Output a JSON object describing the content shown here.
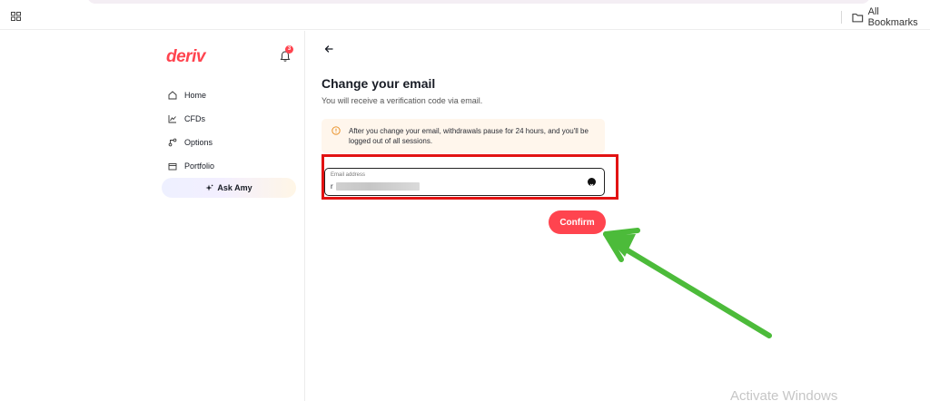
{
  "browser": {
    "bookmarks_label": "All Bookmarks"
  },
  "sidebar": {
    "logo": "deriv",
    "notification_count": "3",
    "items": [
      {
        "label": "Home",
        "icon": "home-icon"
      },
      {
        "label": "CFDs",
        "icon": "chart-icon"
      },
      {
        "label": "Options",
        "icon": "options-icon"
      },
      {
        "label": "Portfolio",
        "icon": "portfolio-icon"
      }
    ],
    "ask_amy": "Ask Amy"
  },
  "main": {
    "title": "Change your email",
    "subtitle": "You will receive a verification code via email.",
    "notice": "After you change your email, withdrawals pause for 24 hours, and you'll be logged out of all sessions.",
    "email": {
      "label": "Email address",
      "value_prefix": "r"
    },
    "confirm_label": "Confirm"
  },
  "colors": {
    "brand": "#ff444f",
    "highlight": "#e21313",
    "arrow": "#4cbb3a"
  },
  "watermark": "Activate Windows"
}
